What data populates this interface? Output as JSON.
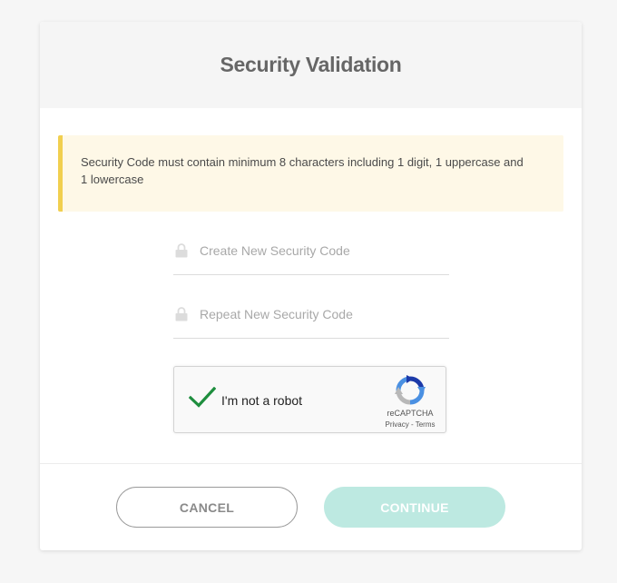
{
  "dialog": {
    "title": "Security Validation",
    "notice_text": "Security Code must contain minimum 8 characters including 1 digit, 1 uppercase and 1 lowercase"
  },
  "form": {
    "new_code_placeholder": "Create New Security Code",
    "repeat_code_placeholder": "Repeat New Security Code",
    "new_code_value": "",
    "repeat_code_value": ""
  },
  "recaptcha": {
    "label": "I'm not a robot",
    "checked": true,
    "brand": "reCAPTCHA",
    "privacy_link": "Privacy",
    "separator": " - ",
    "terms_link": "Terms"
  },
  "actions": {
    "cancel_label": "CANCEL",
    "continue_label": "CONTINUE"
  },
  "colors": {
    "notice_background": "#fef8e7",
    "notice_accent": "#f1cf4f",
    "continue_button": "#bde9e1",
    "check_green": "#1e8e3e",
    "recaptcha_blue": "#1c3aa9",
    "recaptcha_light_blue": "#4a90e2"
  },
  "icons": {
    "field_icon": "lock-icon",
    "check": "checkmark-icon",
    "recaptcha_logo": "recaptcha-logo-icon"
  }
}
